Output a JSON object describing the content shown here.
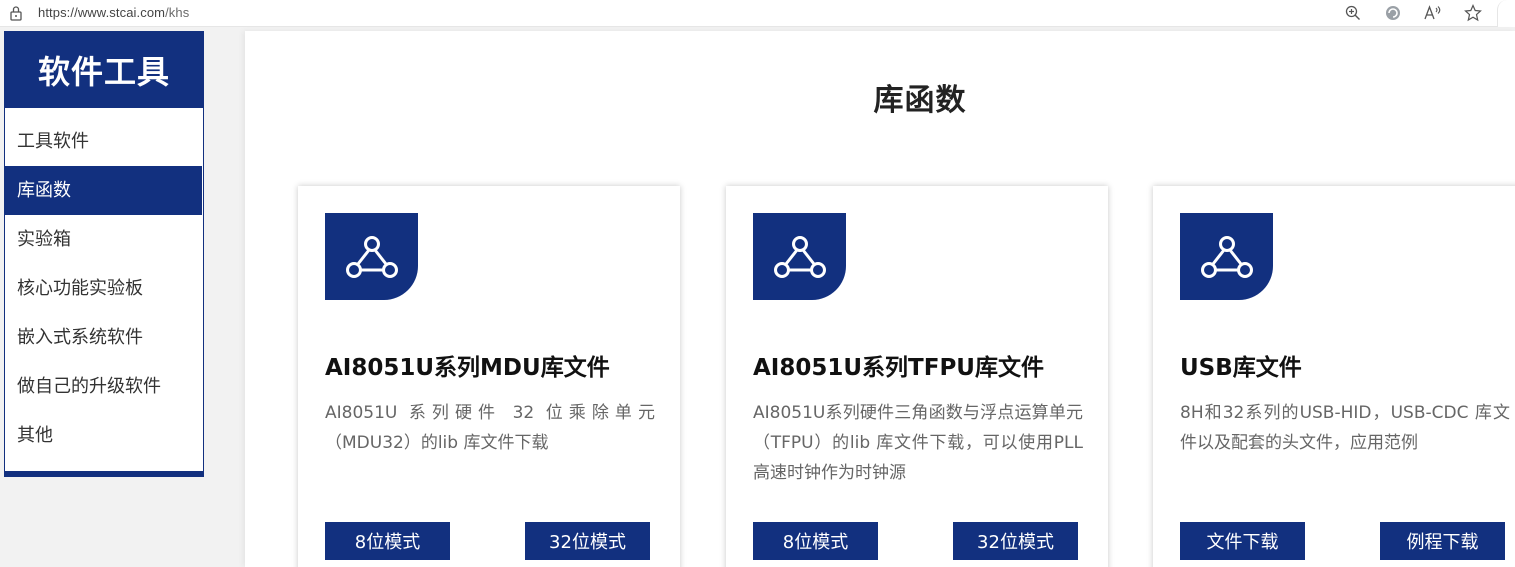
{
  "browser": {
    "url_host": "https://www.stcai.com",
    "url_path": "/khs"
  },
  "sidebar": {
    "title": "软件工具",
    "items": [
      {
        "label": "工具软件"
      },
      {
        "label": "库函数",
        "active": true
      },
      {
        "label": "实验箱"
      },
      {
        "label": "核心功能实验板"
      },
      {
        "label": "嵌入式系统软件"
      },
      {
        "label": "做自己的升级软件"
      },
      {
        "label": "其他"
      }
    ]
  },
  "main": {
    "title": "库函数",
    "cards": [
      {
        "title": "AI8051U系列MDU库文件",
        "description": "AI8051U 系列硬件 32 位乘除单元（MDU32）的lib 库文件下载",
        "buttons": [
          "8位模式",
          "32位模式"
        ]
      },
      {
        "title": "AI8051U系列TFPU库文件",
        "description": "AI8051U系列硬件三角函数与浮点运算单元（TFPU）的lib 库文件下载，可以使用PLL高速时钟作为时钟源",
        "buttons": [
          "8位模式",
          "32位模式"
        ]
      },
      {
        "title": "USB库文件",
        "description": "8H和32系列的USB-HID，USB-CDC 库文件以及配套的头文件，应用范例",
        "buttons": [
          "文件下载",
          "例程下载"
        ]
      }
    ]
  },
  "colors": {
    "brand": "#12307f",
    "background": "#f2f2f2"
  }
}
